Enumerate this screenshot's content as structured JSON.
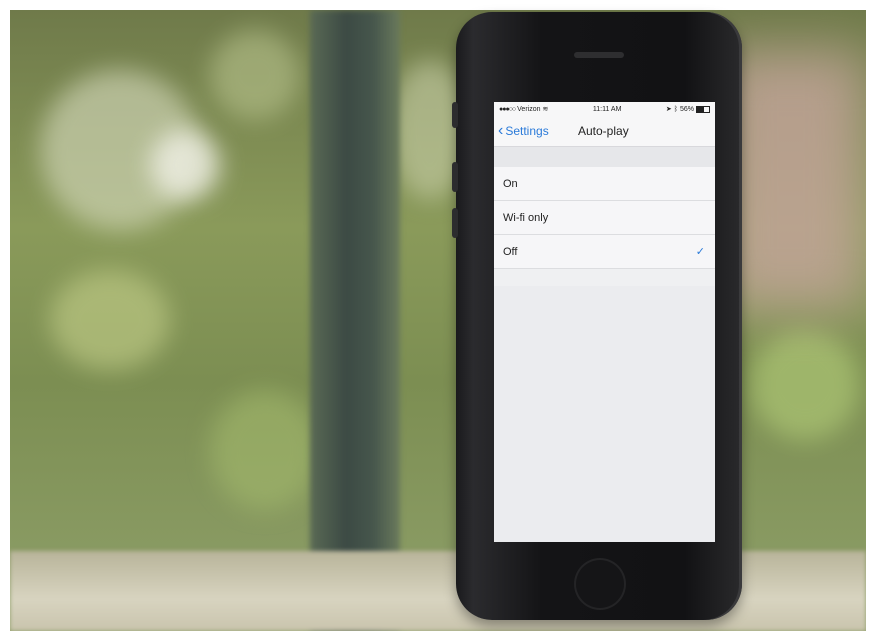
{
  "status_bar": {
    "carrier": "Verizon",
    "time": "11:11 AM",
    "battery": "56%"
  },
  "nav": {
    "back_label": "Settings",
    "title": "Auto-play"
  },
  "options": [
    {
      "label": "On",
      "selected": false
    },
    {
      "label": "Wi-fi only",
      "selected": false
    },
    {
      "label": "Off",
      "selected": true
    }
  ],
  "accent_color": "#2a7ad9"
}
